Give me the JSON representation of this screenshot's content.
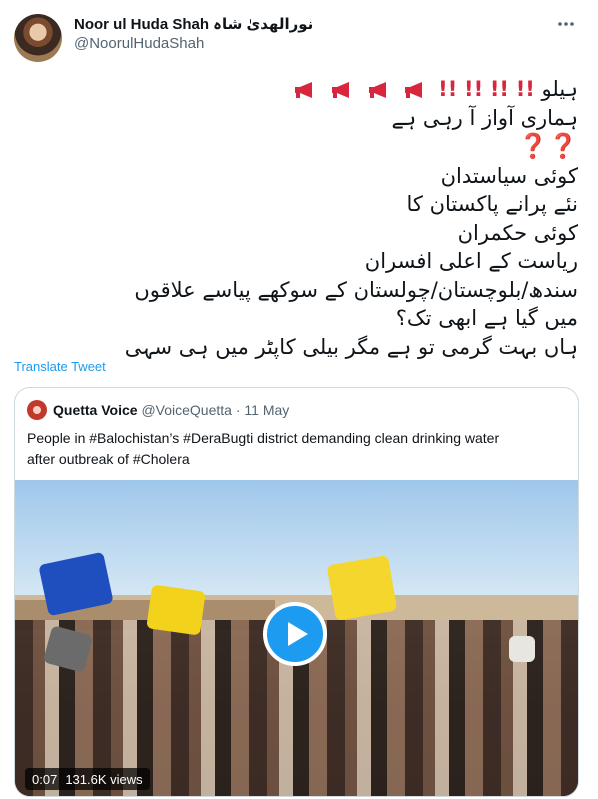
{
  "author": {
    "display_name": "Noor ul Huda Shah",
    "display_name_urdu": "نورالھدیٰ شاہ",
    "handle": "@NoorulHudaShah"
  },
  "tweet": {
    "lines": [
      "ہیلو",
      "ہماری آواز آ رہی ہے",
      "کوئی سیاستدان",
      "نئے پرانے پاکستان کا",
      "کوئی حکمران",
      "ریاست کے اعلی افسران",
      "سندھ/بلوچستان/چولستان کے سوکھے پیاسے علاقوں",
      "میں گیا ہے ابھی تک؟",
      "ہاں بہت گرمی تو ہے مگر بیلی کاپٹر میں ہی سہی"
    ],
    "translate_label": "Translate Tweet"
  },
  "quoted": {
    "display_name": "Quetta Voice",
    "handle": "@VoiceQuetta",
    "separator": "·",
    "date": "11 May",
    "text_line1": "People in #Balochistan’s #DeraBugti district demanding clean drinking water",
    "text_line2": "after outbreak of #Cholera",
    "video": {
      "duration": "0:07",
      "views": "131.6K views"
    }
  },
  "colors": {
    "accent": "#1d9bf0",
    "secondary_text": "#536471",
    "emoji_red": "#d7263d"
  }
}
